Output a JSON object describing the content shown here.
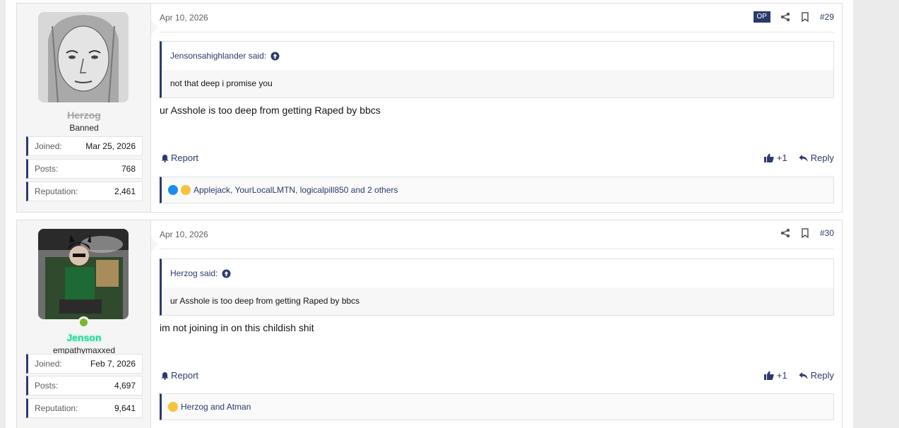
{
  "posts": [
    {
      "user": {
        "name": "Herzog",
        "title": "Banned",
        "stats": [
          {
            "label": "Joined:",
            "value": "Mar 25, 2026"
          },
          {
            "label": "Posts:",
            "value": "768"
          },
          {
            "label": "Reputation:",
            "value": "2,461"
          }
        ]
      },
      "date": "Apr 10, 2026",
      "op_badge": "OP",
      "number": "#29",
      "quote": {
        "author": "Jensonsahighlander said:",
        "text": "not that deep i promise you"
      },
      "message": "ur Asshole is too deep from getting Raped by bbcs",
      "report": "Report",
      "plus_one": "+1",
      "reply": "Reply",
      "reactions_text": "Applejack, YourLocalLMTN, logicalpill850 and 2 others"
    },
    {
      "user": {
        "name": "Jenson",
        "title": "empathymaxxed",
        "stats": [
          {
            "label": "Joined:",
            "value": "Feb 7, 2026"
          },
          {
            "label": "Posts:",
            "value": "4,697"
          },
          {
            "label": "Reputation:",
            "value": "9,641"
          }
        ]
      },
      "date": "Apr 10, 2026",
      "number": "#30",
      "quote": {
        "author": "Herzog said:",
        "text": "ur Asshole is too deep from getting Raped by bbcs"
      },
      "message": "im not joining in on this childish shit",
      "report": "Report",
      "plus_one": "+1",
      "reply": "Reply",
      "reactions_text": "Herzog and Atman"
    }
  ],
  "colors": {
    "accent": "#2b3a6e",
    "online": "#7ab730",
    "username_green": "#2ed3a0",
    "banned_gray": "#a3a3a3"
  }
}
